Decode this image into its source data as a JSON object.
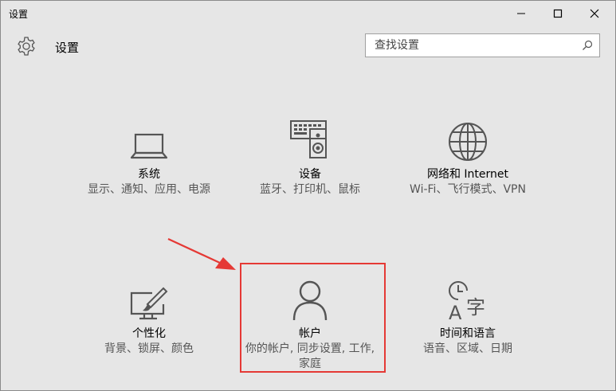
{
  "window": {
    "title": "设置",
    "controls": {
      "minimize_icon": "minimize-icon",
      "maximize_icon": "maximize-icon",
      "close_icon": "close-icon"
    }
  },
  "header": {
    "icon": "gear-icon",
    "title": "设置",
    "search": {
      "placeholder": "查找设置",
      "value": "",
      "icon": "search-icon"
    }
  },
  "categories": [
    {
      "name": "系统",
      "description": "显示、通知、应用、电源",
      "icon": "laptop-icon"
    },
    {
      "name": "设备",
      "description": "蓝牙、打印机、鼠标",
      "icon": "keyboard-speaker-icon"
    },
    {
      "name": "网络和 Internet",
      "description": "Wi-Fi、飞行模式、VPN",
      "icon": "globe-icon"
    },
    {
      "name": "个性化",
      "description": "背景、锁屏、颜色",
      "icon": "monitor-brush-icon"
    },
    {
      "name": "帐户",
      "description": "你的帐户, 同步设置, 工作, 家庭",
      "icon": "person-icon"
    },
    {
      "name": "时间和语言",
      "description": "语音、区域、日期",
      "icon": "time-language-icon"
    }
  ],
  "annotation": {
    "highlighted_category": "帐户",
    "color": "#e53935"
  },
  "colors": {
    "background": "#e6e6e6",
    "icon": "#555555",
    "description_text": "#555555"
  }
}
